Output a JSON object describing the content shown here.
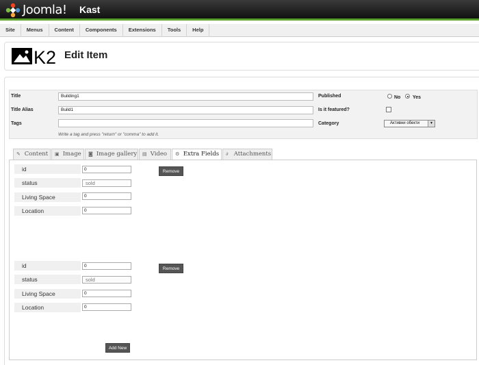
{
  "header": {
    "brand": "Joomla!",
    "site_name": "Kast"
  },
  "menu": [
    "Site",
    "Menus",
    "Content",
    "Components",
    "Extensions",
    "Tools",
    "Help"
  ],
  "page": {
    "logo_text": "K2",
    "title": "Edit Item"
  },
  "form": {
    "title_label": "Title",
    "title_value": "Building1",
    "alias_label": "Title Alias",
    "alias_value": "Build1",
    "tags_label": "Tags",
    "tags_value": "",
    "tags_hint": "Write a tag and press \"return\" or \"comma\" to add it.",
    "published_label": "Published",
    "published_no": "No",
    "published_yes": "Yes",
    "featured_label": "Is it featured?",
    "category_label": "Category",
    "category_value": "Активни обекти"
  },
  "tabs": [
    {
      "label": "Content",
      "icon": "content-icon"
    },
    {
      "label": "Image",
      "icon": "image-icon"
    },
    {
      "label": "Image gallery",
      "icon": "camera-icon"
    },
    {
      "label": "Video",
      "icon": "film-icon"
    },
    {
      "label": "Extra Fields",
      "icon": "gears-icon",
      "active": true
    },
    {
      "label": "Attachments",
      "icon": "paperclip-icon"
    }
  ],
  "extra_fields": {
    "groups": [
      {
        "id": "0",
        "status": "sold",
        "living_space": "0",
        "location": "0",
        "remove_label": "Remove"
      },
      {
        "id": "0",
        "status": "sold",
        "living_space": "0",
        "location": "0",
        "remove_label": "Remove"
      }
    ],
    "labels": {
      "id": "id",
      "status": "status",
      "living_space": "Living Space",
      "location": "Location"
    },
    "add_new_label": "Add New"
  },
  "colors": {
    "header_bg": "#1a1a1a",
    "accent_green": "#5aa02c",
    "button_bg": "#555555"
  }
}
